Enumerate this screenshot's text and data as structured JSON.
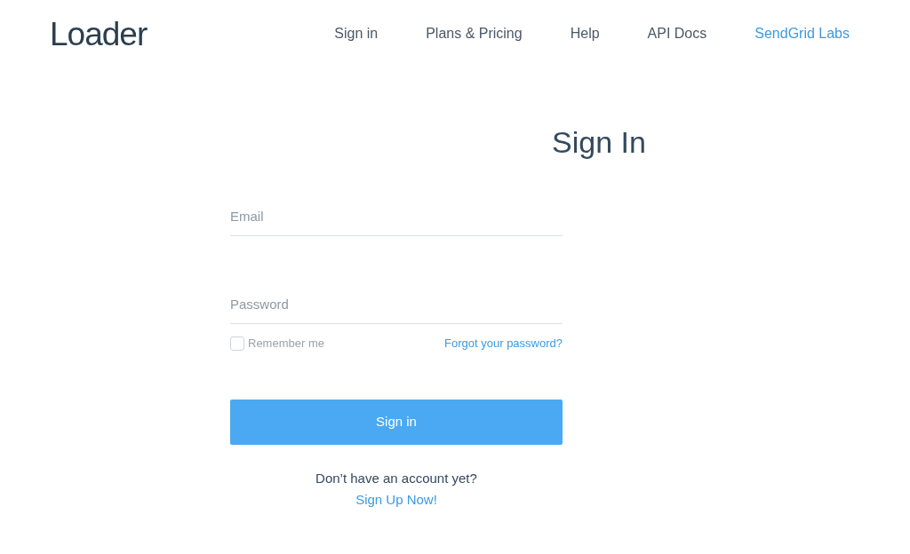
{
  "logo": "Loader",
  "nav": [
    {
      "label": "Sign in",
      "highlighted": false
    },
    {
      "label": "Plans & Pricing",
      "highlighted": false
    },
    {
      "label": "Help",
      "highlighted": false
    },
    {
      "label": "API Docs",
      "highlighted": false
    },
    {
      "label": "SendGrid Labs",
      "highlighted": true
    }
  ],
  "title": "Sign In",
  "fields": [
    {
      "placeholder": "Email"
    },
    {
      "placeholder": "Password"
    }
  ],
  "remember": {
    "label": "Remember me",
    "checked": false
  },
  "forgot_link": "Forgot your password?",
  "submit": "Sign in",
  "signup_prompt": "Don’t have an account yet?",
  "signup_link": "Sign Up Now!"
}
